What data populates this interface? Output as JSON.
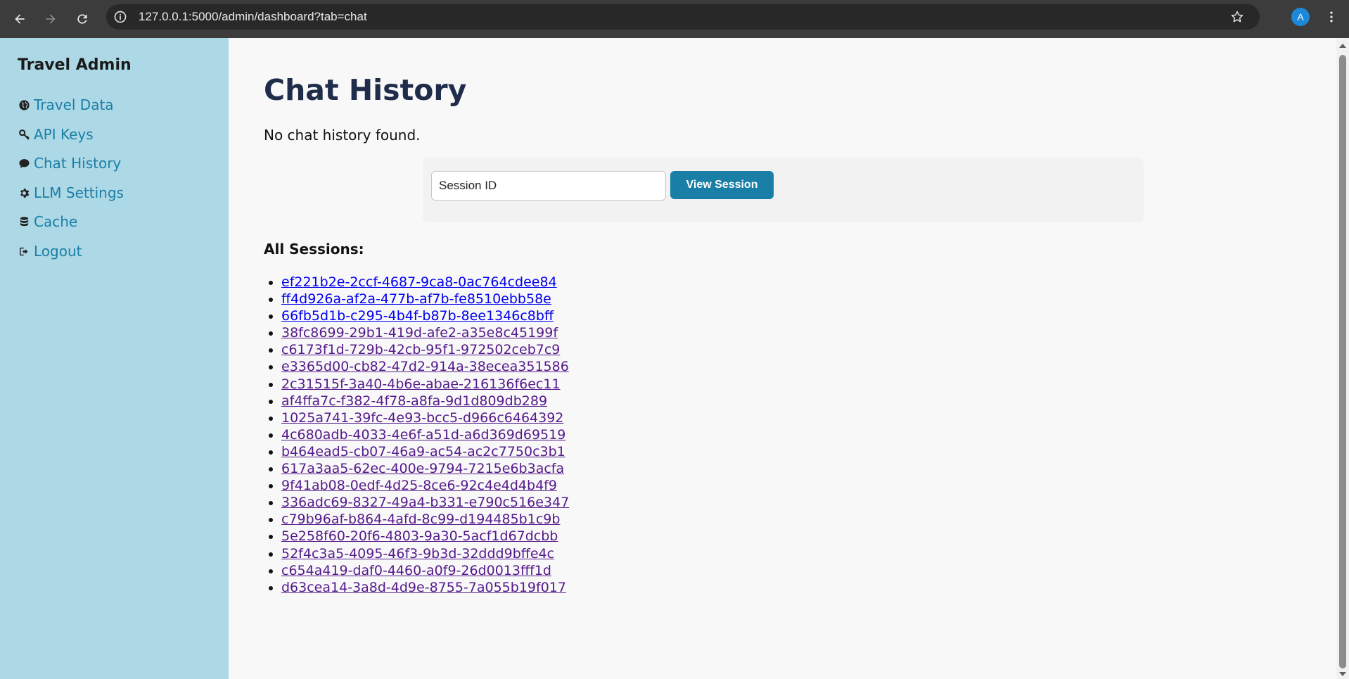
{
  "browser": {
    "url": "127.0.0.1:5000/admin/dashboard?tab=chat",
    "profile_initial": "A"
  },
  "sidebar": {
    "title": "Travel Admin",
    "items": [
      {
        "label": "Travel Data",
        "icon": "globe-icon"
      },
      {
        "label": "API Keys",
        "icon": "key-icon"
      },
      {
        "label": "Chat History",
        "icon": "comment-icon"
      },
      {
        "label": "LLM Settings",
        "icon": "gear-icon"
      },
      {
        "label": "Cache",
        "icon": "database-icon"
      },
      {
        "label": "Logout",
        "icon": "sign-out-icon"
      }
    ]
  },
  "main": {
    "title": "Chat History",
    "empty_message": "No chat history found.",
    "session_input": {
      "placeholder": "Session ID",
      "value": ""
    },
    "view_button_label": "View Session",
    "sessions_heading": "All Sessions:",
    "sessions": [
      "ef221b2e-2ccf-4687-9ca8-0ac764cdee84",
      "ff4d926a-af2a-477b-af7b-fe8510ebb58e",
      "66fb5d1b-c295-4b4f-b87b-8ee1346c8bff",
      "38fc8699-29b1-419d-afe2-a35e8c45199f",
      "c6173f1d-729b-42cb-95f1-972502ceb7c9",
      "e3365d00-cb82-47d2-914a-38ecea351586",
      "2c31515f-3a40-4b6e-abae-216136f6ec11",
      "af4ffa7c-f382-4f78-a8fa-9d1d809db289",
      "1025a741-39fc-4e93-bcc5-d966c6464392",
      "4c680adb-4033-4e6f-a51d-a6d369d69519",
      "b464ead5-cb07-46a9-ac54-ac2c7750c3b1",
      "617a3aa5-62ec-400e-9794-7215e6b3acfa",
      "9f41ab08-0edf-4d25-8ce6-92c4e4d4b4f9",
      "336adc69-8327-49a4-b331-e790c516e347",
      "c79b96af-b864-4afd-8c99-d194485b1c9b",
      "5e258f60-20f6-4803-9a30-5acf1d67dcbb",
      "52f4c3a5-4095-46f3-9b3d-32ddd9bffe4c",
      "c654a419-daf0-4460-a0f9-26d0013fff1d",
      "d63cea14-3a8d-4d9e-8755-7a055b19f017"
    ]
  },
  "colors": {
    "sidebar_bg": "#add8e6",
    "link_accent": "#1a7fa6",
    "title": "#1f2d4a",
    "visited_link": "#551a8b",
    "unvisited_link": "#0000ee"
  }
}
